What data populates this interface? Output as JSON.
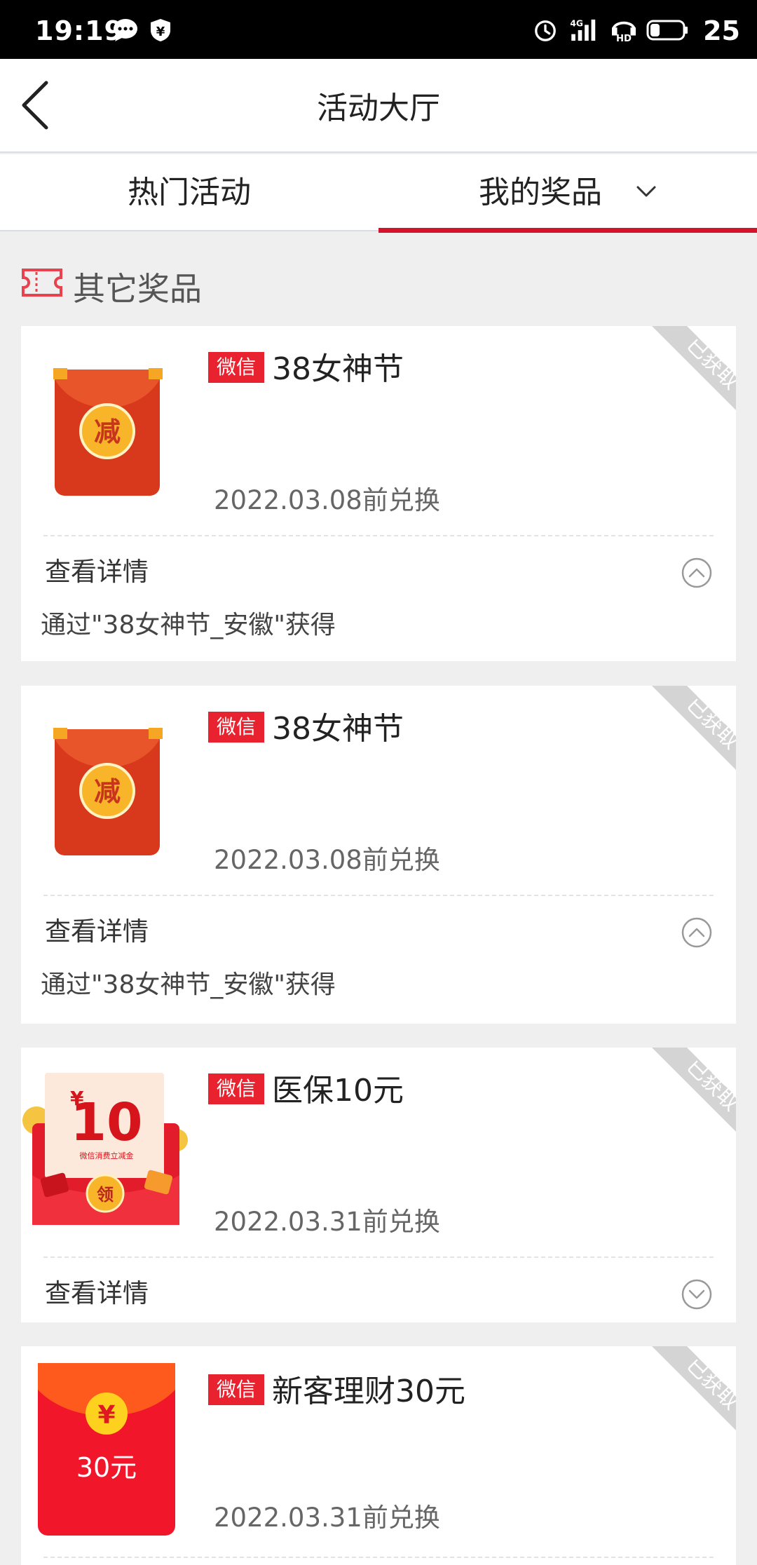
{
  "status_bar": {
    "time": "19:19",
    "battery": "25",
    "network": "4G",
    "icons": [
      "chat-bubble-icon",
      "shield-yen-icon",
      "alarm-icon",
      "signal-icon",
      "hd-icon",
      "battery-icon"
    ]
  },
  "header": {
    "title": "活动大厅"
  },
  "tabs": [
    {
      "label": "热门活动",
      "active": false
    },
    {
      "label": "我的奖品",
      "active": true
    }
  ],
  "section": {
    "title": "其它奖品"
  },
  "cards": [
    {
      "badge": "微信",
      "name": "38女神节",
      "expire": "2022.03.08前兑换",
      "status": "已获取",
      "detail_label": "查看详情",
      "detail_text": "通过\"38女神节_安徽\"获得",
      "expanded": true,
      "image_char": "减"
    },
    {
      "badge": "微信",
      "name": "38女神节",
      "expire": "2022.03.08前兑换",
      "status": "已获取",
      "detail_label": "查看详情",
      "detail_text": "通过\"38女神节_安徽\"获得",
      "expanded": true,
      "image_char": "减"
    },
    {
      "badge": "微信",
      "name": "医保10元",
      "expire": "2022.03.31前兑换",
      "status": "已获取",
      "detail_label": "查看详情",
      "expanded": false,
      "image_amount": "10",
      "image_currency": "¥",
      "image_caption": "微信消费立减金",
      "image_button": "领"
    },
    {
      "badge": "微信",
      "name": "新客理财30元",
      "expire": "2022.03.31前兑换",
      "status": "已获取",
      "image_currency": "¥",
      "image_amount": "30元"
    }
  ],
  "colors": {
    "accent": "#d5122b",
    "badge": "#e8222f",
    "background": "#efefef"
  }
}
